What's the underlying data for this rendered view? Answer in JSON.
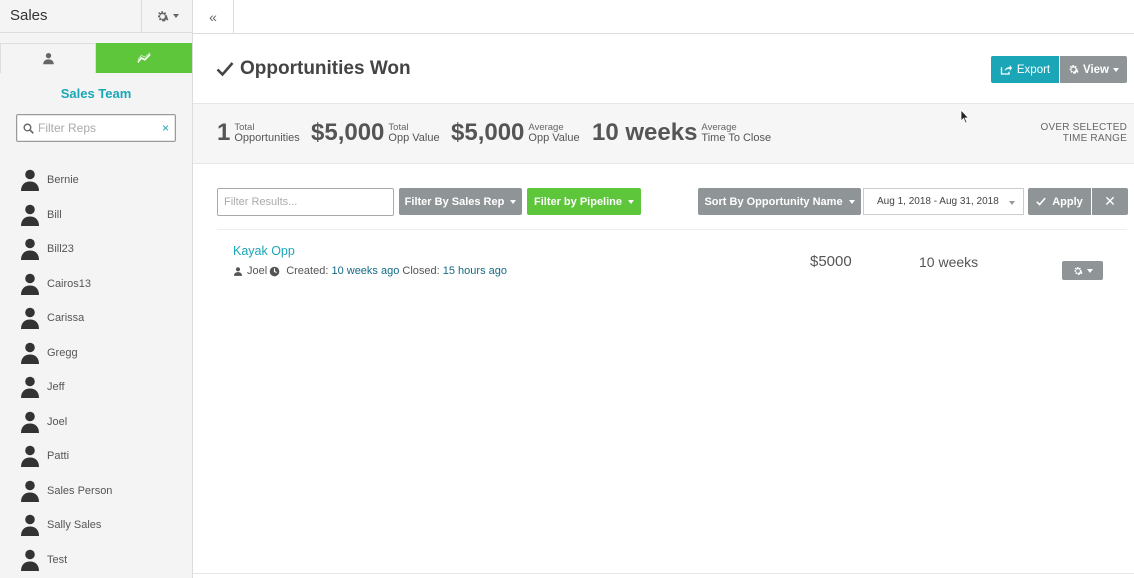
{
  "sidebar": {
    "title": "Sales",
    "team_title": "Sales Team",
    "filter_placeholder": "Filter Reps",
    "clear_symbol": "×",
    "reps": [
      "Bernie",
      "Bill",
      "Bill23",
      "Cairos13",
      "Carissa",
      "Gregg",
      "Jeff",
      "Joel",
      "Patti",
      "Sales Person",
      "Sally Sales",
      "Test"
    ]
  },
  "topbar": {
    "collapse_symbol": "«"
  },
  "header": {
    "title": "Opportunities Won",
    "export_label": "Export",
    "view_label": "View"
  },
  "stats": {
    "total_opps": {
      "value": "1",
      "label1": "Total",
      "label2": "Opportunities"
    },
    "total_value": {
      "value": "$5,000",
      "label1": "Total",
      "label2": "Opp Value"
    },
    "avg_value": {
      "value": "$5,000",
      "label1": "Average",
      "label2": "Opp Value"
    },
    "avg_time": {
      "value": "10 weeks",
      "label1": "Average",
      "label2": "Time To Close"
    },
    "range_note1": "OVER SELECTED",
    "range_note2": "TIME RANGE"
  },
  "filters": {
    "results_placeholder": "Filter Results...",
    "sales_rep_label": "Filter By Sales Rep",
    "pipeline_label": "Filter by Pipeline",
    "sort_label": "Sort By Opportunity Name",
    "date_range": "Aug 1, 2018 - Aug 31, 2018",
    "apply_label": "Apply",
    "close_symbol": "✕"
  },
  "opportunity": {
    "name": "Kayak Opp",
    "owner": "Joel",
    "created_label": "Created:",
    "created_value": "10 weeks ago",
    "closed_label": "Closed:",
    "closed_value": "15 hours ago",
    "value": "$5000",
    "time": "10 weeks"
  },
  "colors": {
    "accent": "#1aa6b7",
    "green": "#5ec63a",
    "grey_button": "#8f9596"
  },
  "icons": [
    "gear-icon",
    "person-icon",
    "line-chart-icon",
    "search-icon",
    "checkmark-icon",
    "export-icon",
    "clock-icon",
    "user-silhouette-icon"
  ]
}
